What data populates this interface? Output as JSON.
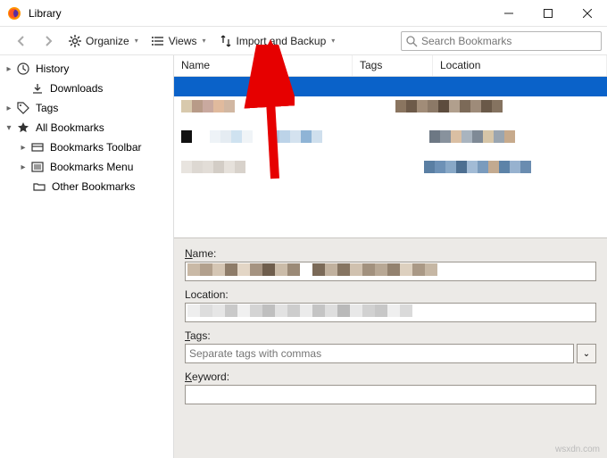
{
  "window": {
    "title": "Library"
  },
  "toolbar": {
    "organize": "Organize",
    "views": "Views",
    "import_backup": "Import and Backup",
    "search_placeholder": "Search Bookmarks"
  },
  "sidebar": {
    "history": "History",
    "downloads": "Downloads",
    "tags": "Tags",
    "all_bookmarks": "All Bookmarks",
    "bookmarks_toolbar": "Bookmarks Toolbar",
    "bookmarks_menu": "Bookmarks Menu",
    "other_bookmarks": "Other Bookmarks"
  },
  "columns": {
    "name": "Name",
    "tags": "Tags",
    "location": "Location"
  },
  "details": {
    "name_label": "Name:",
    "location_label": "Location:",
    "tags_label": "Tags:",
    "tags_placeholder": "Separate tags with commas",
    "keyword_label": "Keyword:"
  },
  "watermark": "wsxdn.com"
}
